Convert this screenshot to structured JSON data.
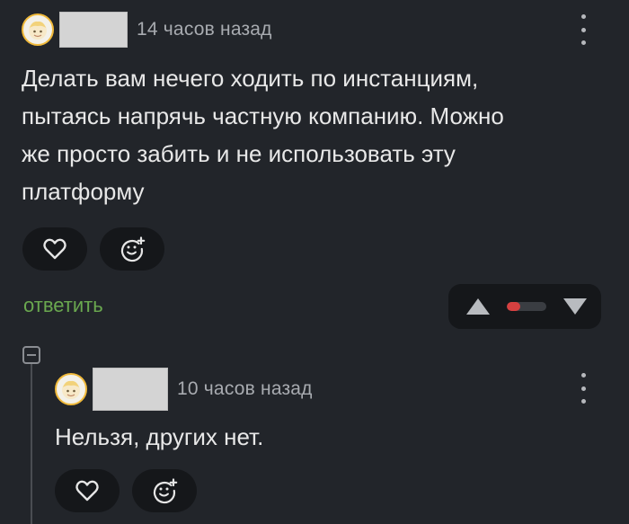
{
  "comment1": {
    "timestamp": "14 часов назад",
    "text_lines": [
      "Делать вам нечего ходить по инстанциям,",
      "пытаясь напрячь частную компанию. Можно",
      "же просто забить и не использовать эту",
      "платформу"
    ],
    "actions": {
      "like_icon": "heart-icon",
      "react_icon": "smiley-plus-icon"
    },
    "reply_label": "ответить",
    "vote": {
      "rating_fraction": 0.35,
      "bar_color": "#d64040"
    }
  },
  "comment2": {
    "timestamp": "10 часов назад",
    "text_lines": [
      "Нельзя, других нет."
    ],
    "actions": {
      "like_icon": "heart-icon",
      "react_icon": "smiley-plus-icon"
    }
  },
  "colors": {
    "background": "#22252a",
    "reply_link": "#6aa84f",
    "avatar_ring": "#f0b93a"
  }
}
